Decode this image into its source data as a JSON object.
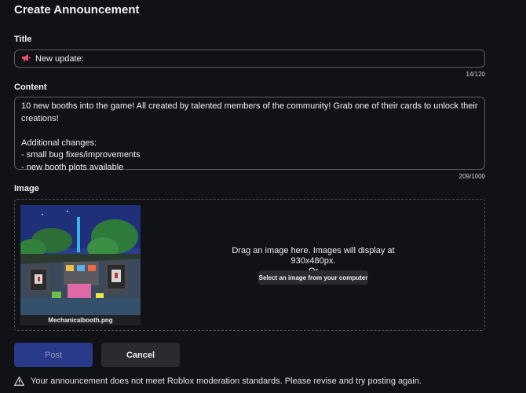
{
  "page": {
    "title": "Create Announcement"
  },
  "title_field": {
    "label": "Title",
    "icon": "megaphone-icon",
    "value": "New update:",
    "counter": "14/120"
  },
  "content_field": {
    "label": "Content",
    "lines": [
      "10 new booths into the game! All created by talented members of the community! Grab one of their cards to unlock their",
      "creations!",
      "",
      "Additional changes:",
      "- small bug fixes/improvements",
      "- new booth plots available"
    ],
    "counter": "209/1000"
  },
  "image_field": {
    "label": "Image",
    "filename": "Mechanicalbooth.png",
    "drop_text": "Drag an image here. Images will display at 930x480px.",
    "or_text": "- Or -",
    "select_label": "Select an image from your computer"
  },
  "actions": {
    "post_label": "Post",
    "cancel_label": "Cancel"
  },
  "warning": {
    "icon": "warning-icon",
    "text": "Your announcement does not meet Roblox moderation standards. Please revise and try posting again."
  },
  "colors": {
    "background": "#111216",
    "post_button": "#2a3a8a",
    "secondary_button": "#2a2b30",
    "border": "#5b5d63"
  }
}
